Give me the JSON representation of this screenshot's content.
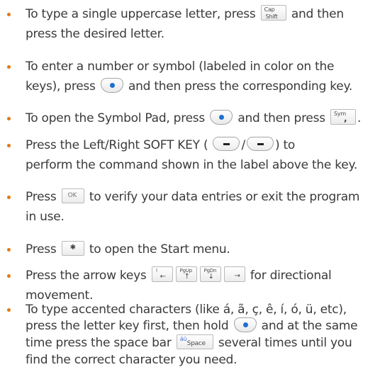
{
  "colors": {
    "bullet": "#e07a12",
    "text": "#3a3a3a",
    "dot_key": "#1f6fd1"
  },
  "keys": {
    "cap_top": "Cap",
    "cap_bottom": "Shift",
    "sym_top": "Sym",
    "sym_bottom": ",",
    "ok": "OK",
    "start": "✱",
    "arrow1_top": "!",
    "arrow1_bottom": "←",
    "arrow2_top": "PgUp",
    "arrow2_bottom": "↑",
    "arrow3_top": "PgDn",
    "arrow3_bottom": "↓",
    "arrow4_bottom": "→",
    "space_top": "áü",
    "space_bottom": "Space"
  },
  "items": [
    {
      "lines": [
        "To type a single uppercase letter, press",
        "and then",
        "press the desired letter."
      ]
    },
    {
      "lines": [
        "To enter a number or symbol (labeled in color on the",
        "keys), press",
        "and then press the corresponding key."
      ]
    },
    {
      "lines": [
        "To open the Symbol Pad, press",
        "and then press",
        "."
      ]
    },
    {
      "lines": [
        "Press the Left/Right SOFT KEY (",
        "/",
        ") to",
        "perform the command shown in the label above the key."
      ]
    },
    {
      "lines": [
        "Press",
        "to verify your data entries or exit the program",
        "in use."
      ]
    },
    {
      "lines": [
        "Press",
        "to open the Start menu."
      ]
    },
    {
      "lines": [
        "Press the arrow keys",
        "for directional",
        "movement."
      ]
    },
    {
      "lines": [
        "To type accented characters (like á, ã, ç, ê, í, ó, ü, etc),",
        "press the letter key first, then hold",
        "and at the same",
        "time press the space bar",
        "several times until you",
        "find the correct character you need."
      ]
    }
  ]
}
